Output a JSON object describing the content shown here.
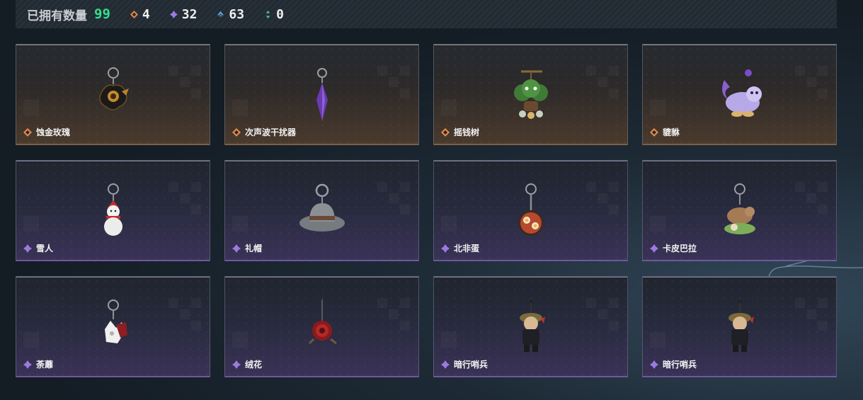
{
  "header": {
    "owned_label": "已拥有数量",
    "owned_count": "99",
    "stats": [
      {
        "icon": "orange-diamond-icon",
        "color": "#e08a4e",
        "value": "4"
      },
      {
        "icon": "purple-diamond-icon",
        "color": "#9b7be0",
        "value": "32"
      },
      {
        "icon": "blue-chevron-icon",
        "color": "#5aa8e8",
        "value": "63"
      },
      {
        "icon": "green-arrows-icon",
        "color": "#3fd08a",
        "value": "0"
      }
    ]
  },
  "colors": {
    "gold_rarity": "#e08a4e",
    "purple_rarity": "#9b7be0",
    "accent_green": "#2fe08b"
  },
  "items": [
    {
      "name": "蚀金玫瑰",
      "rarity": "gold",
      "icon": "black-gold-rose-charm-icon"
    },
    {
      "name": "次声波干扰器",
      "rarity": "gold",
      "icon": "purple-crystal-charm-icon"
    },
    {
      "name": "摇钱树",
      "rarity": "gold",
      "icon": "money-tree-charm-icon"
    },
    {
      "name": "貔貅",
      "rarity": "gold",
      "icon": "pixiu-charm-icon"
    },
    {
      "name": "雪人",
      "rarity": "purple",
      "icon": "snowman-charm-icon"
    },
    {
      "name": "礼帽",
      "rarity": "purple",
      "icon": "fedora-hat-charm-icon"
    },
    {
      "name": "北非蛋",
      "rarity": "purple",
      "icon": "shakshuka-pan-charm-icon"
    },
    {
      "name": "卡皮巴拉",
      "rarity": "purple",
      "icon": "capybara-charm-icon"
    },
    {
      "name": "荼蘼",
      "rarity": "purple",
      "icon": "white-flower-charm-icon"
    },
    {
      "name": "绒花",
      "rarity": "purple",
      "icon": "red-rose-charm-icon"
    },
    {
      "name": "暗行哨兵",
      "rarity": "purple",
      "icon": "soldier-figure-charm-icon"
    },
    {
      "name": "暗行哨兵",
      "rarity": "purple",
      "icon": "soldier-figure-charm-icon"
    }
  ]
}
